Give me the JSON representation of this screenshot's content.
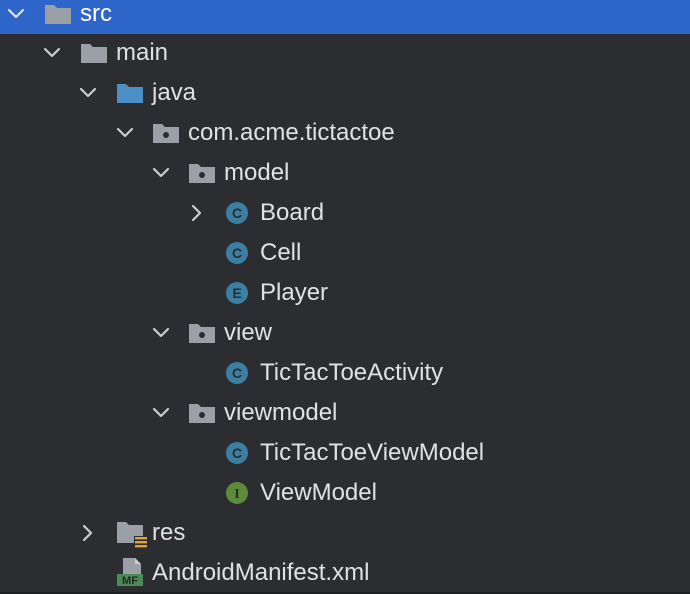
{
  "project_tree": {
    "items": [
      {
        "label": "src",
        "icon": "folder-icon",
        "expanded": true,
        "selected": true
      },
      {
        "label": "main",
        "icon": "folder-icon",
        "expanded": true
      },
      {
        "label": "java",
        "icon": "source-folder-icon",
        "expanded": true
      },
      {
        "label": "com.acme.tictactoe",
        "icon": "package-icon",
        "expanded": true
      },
      {
        "label": "model",
        "icon": "package-icon",
        "expanded": true
      },
      {
        "label": "Board",
        "icon": "class-icon",
        "icon_letter": "C",
        "expanded": false
      },
      {
        "label": "Cell",
        "icon": "class-icon",
        "icon_letter": "C"
      },
      {
        "label": "Player",
        "icon": "enum-icon",
        "icon_letter": "E"
      },
      {
        "label": "view",
        "icon": "package-icon",
        "expanded": true
      },
      {
        "label": "TicTacToeActivity",
        "icon": "class-icon",
        "icon_letter": "C"
      },
      {
        "label": "viewmodel",
        "icon": "package-icon",
        "expanded": true
      },
      {
        "label": "TicTacToeViewModel",
        "icon": "class-icon",
        "icon_letter": "C"
      },
      {
        "label": "ViewModel",
        "icon": "interface-icon",
        "icon_letter": "I"
      },
      {
        "label": "res",
        "icon": "resource-folder-icon",
        "expanded": false
      },
      {
        "label": "AndroidManifest.xml",
        "icon": "manifest-file-icon",
        "icon_letter": "MF"
      }
    ]
  },
  "colors": {
    "background": "#2b2d30",
    "selection": "#2e65c9",
    "text": "#dfe1e5",
    "folder": "#9aa0a6",
    "source_folder": "#4b8fc6",
    "class_badge": "#3d7fa3",
    "enum_badge": "#3d7fa3",
    "interface_badge": "#5c8b3c",
    "manifest_badge": "#4c8b58",
    "resource_lines": "#e2a33a"
  }
}
